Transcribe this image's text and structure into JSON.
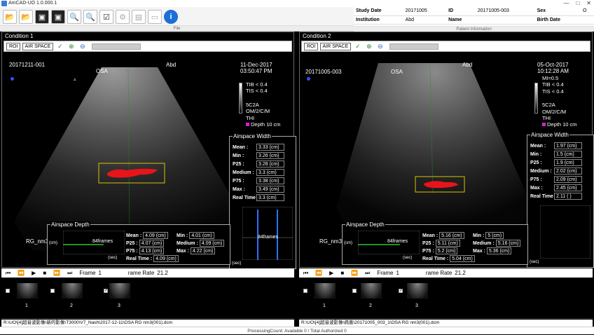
{
  "app": {
    "title": "AmCAD-UO 1.0.000.1"
  },
  "toolbar": {
    "group_label": "File"
  },
  "patient": {
    "group_label": "Patient Information",
    "study_date_label": "Study Date",
    "study_date": "20171005",
    "id_label": "ID",
    "id": "20171005-003",
    "sex_label": "Sex",
    "sex": "O",
    "institution_label": "Institution",
    "institution": "Abd",
    "name_label": "Name",
    "name": "",
    "birth_label": "Birth Date",
    "birth": ""
  },
  "conditions": [
    {
      "header": "Condition 1",
      "roi": "ROI",
      "mode": "AIR SPACE",
      "patient_id": "20171211-001",
      "diagnosis": "OSA",
      "institution": "Abd",
      "date": "11-Dec-2017",
      "time": "03:50:47 PM",
      "legend": [
        "TIB < 0.4",
        "TIS < 0.4",
        "5C2A",
        "OM/2/C/M",
        "THI",
        "Depth 10 cm"
      ],
      "mi": "",
      "rg_label": "RG_nm3",
      "airspace_width": {
        "title": "Airspace Width",
        "rows": [
          {
            "label": "Mean :",
            "value": "3.33",
            "unit": "(cm)"
          },
          {
            "label": "Min :",
            "value": "3.26",
            "unit": "(cm)"
          },
          {
            "label": "P25 :",
            "value": "3.28",
            "unit": "(cm)"
          },
          {
            "label": "Medium :",
            "value": "3.3",
            "unit": "(cm)"
          },
          {
            "label": "P75 :",
            "value": "3.38",
            "unit": "(cm)"
          },
          {
            "label": "Max :",
            "value": "3.49",
            "unit": "(cm)"
          },
          {
            "label": "Real Time :",
            "value": "3.3",
            "unit": "(cm)"
          }
        ],
        "frames": "84frames",
        "x_unit": "(sec)"
      },
      "airspace_depth": {
        "title": "Airspace Depth",
        "frames": "84frames",
        "y_unit": "(cm)",
        "x_unit": "(sec)",
        "mean_label": "Mean :",
        "mean": "4.09 (cm)",
        "min_label": "Min :",
        "min": "4.01 (cm)",
        "p25_label": "P25 :",
        "p25": "4.07 (cm)",
        "medium_label": "Medium :",
        "medium": "4.09 (cm)",
        "p75_label": "P75 :",
        "p75": "4.13 (cm)",
        "max_label": "Max :",
        "max": "4.22 (cm)",
        "rt_label": "Real Time :",
        "rt": "4.09 (cm)"
      },
      "player": {
        "frame_label": "Frame",
        "frame_value": "1",
        "rate_label": "rame Rate",
        "rate_value": "21.2"
      },
      "thumbs": [
        "1",
        "2",
        "3"
      ],
      "path": "R:\\UO\\[4]超音波影像\\新的影像\\T3000\\V7_Nash\\2017-12-11\\OSA RG nm3(001).dcm"
    },
    {
      "header": "Condition 2",
      "roi": "ROI",
      "mode": "AIR SPACE",
      "patient_id": "20171005-003",
      "diagnosis": "OSA",
      "institution": "Abd",
      "date": "05-Oct-2017",
      "time": "10:12:28 AM",
      "legend": [
        "TIB < 0.4",
        "TIS < 0.4",
        "5C2A",
        "OM/2/C/M",
        "THI",
        "Depth 10 cm"
      ],
      "mi": "MI=0.5",
      "rg_label": "RG_nm3",
      "airspace_width": {
        "title": "Airspace Width",
        "rows": [
          {
            "label": "Mean :",
            "value": "1.97",
            "unit": "(cm)"
          },
          {
            "label": "Min :",
            "value": "1.5",
            "unit": "(cm)"
          },
          {
            "label": "P25 :",
            "value": "1.9",
            "unit": "(cm)"
          },
          {
            "label": "Medium :",
            "value": "2.02",
            "unit": "(cm)"
          },
          {
            "label": "P75 :",
            "value": "2.09",
            "unit": "(cm)"
          },
          {
            "label": "Max :",
            "value": "2.45",
            "unit": "(cm)"
          },
          {
            "label": "Real Time :",
            "value": "2.11",
            "unit": "( )"
          }
        ],
        "frames": "",
        "x_unit": "(sec)"
      },
      "airspace_depth": {
        "title": "Airspace Depth",
        "frames": "84frames",
        "y_unit": "(cm)",
        "x_unit": "(sec)",
        "mean_label": "Mean :",
        "mean": "5.16 (cm)",
        "min_label": "Min :",
        "min": "5 (cm)",
        "p25_label": "P25 :",
        "p25": "5.11 (cm)",
        "medium_label": "Medium :",
        "medium": "5.16 (cm)",
        "p75_label": "P75 :",
        "p75": "5.2 (cm)",
        "max_label": "Max :",
        "max": "5.36 (cm)",
        "rt_label": "Real Time :",
        "rt": "5.04 (cm)"
      },
      "player": {
        "frame_label": "Frame",
        "frame_value": "1",
        "rate_label": "rame Rate",
        "rate_value": "21.2"
      },
      "thumbs": [
        "1",
        "2",
        "3"
      ],
      "path": "R:\\UO\\[4]超音波影像\\病患\\20171005_003_1\\OSA RG nm3(001).dcm"
    }
  ],
  "status": "ProcessingCount: Available 0 / Total Authorized 0"
}
